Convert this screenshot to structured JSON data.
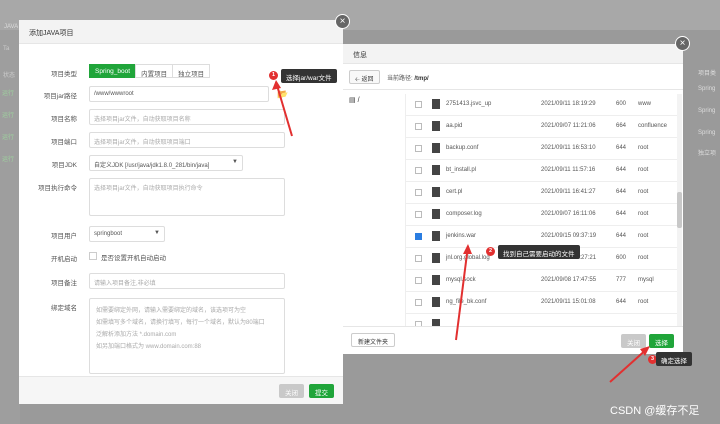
{
  "background": {
    "top_title": "JAVA",
    "left_items": [
      "Ta",
      "状态",
      "运行",
      "运行",
      "运行",
      "运行"
    ],
    "right_items": [
      "项目类",
      "Spring",
      "Spring",
      "Spring",
      "独立项"
    ]
  },
  "dialog": {
    "title": "添加JAVA项目",
    "close_icon": "×",
    "project_type": {
      "label": "项目类型",
      "options": [
        "Spring_boot",
        "内置项目",
        "独立项目"
      ],
      "selected": "Spring_boot"
    },
    "jar_path": {
      "label": "项目jar路径",
      "value": "/www/wwwroot"
    },
    "name": {
      "label": "项目名称",
      "placeholder": "选择项目jar文件，自动获取项目名称"
    },
    "port": {
      "label": "项目端口",
      "placeholder": "选择项目jar文件，自动获取项目端口"
    },
    "jdk": {
      "label": "项目JDK",
      "value": "自定义JDK [/usr/java/jdk1.8.0_281/bin/java]"
    },
    "command": {
      "label": "项目执行命令",
      "placeholder": "选择项目jar文件，自动获取项目执行命令"
    },
    "user": {
      "label": "项目用户",
      "value": "springboot"
    },
    "autostart": {
      "label": "开机启动",
      "text": "是否设置开机自动启动"
    },
    "remark": {
      "label": "项目备注",
      "placeholder": "请输入项目备注,非必填"
    },
    "domain": {
      "label": "绑定域名",
      "lines": [
        "如需要绑定外网，请输入需要绑定的域名，该选项可为空",
        "如需填写多个域名，请换行填写，每行一个域名，默认为80端口",
        "泛解析添加方法 *.domain.com",
        "如另加端口格式为 www.domain.com:88"
      ]
    },
    "close_button": "关闭",
    "submit_button": "提交"
  },
  "file_picker": {
    "title": "信息",
    "back_button": "返回",
    "current_path_label": "当前路径:",
    "current_path": "/tmp/",
    "tree_root": "/",
    "files": [
      {
        "name": "2751413.jsvc_up",
        "date": "2021/09/11 18:19:29",
        "perm": "600",
        "owner": "www",
        "checked": false
      },
      {
        "name": "aa.pid",
        "date": "2021/09/07 11:21:06",
        "perm": "664",
        "owner": "confluence",
        "checked": false
      },
      {
        "name": "backup.conf",
        "date": "2021/09/11 16:53:10",
        "perm": "644",
        "owner": "root",
        "checked": false
      },
      {
        "name": "bt_install.pl",
        "date": "2021/09/11 11:57:16",
        "perm": "644",
        "owner": "root",
        "checked": false
      },
      {
        "name": "cert.pl",
        "date": "2021/09/11 16:41:27",
        "perm": "644",
        "owner": "root",
        "checked": false
      },
      {
        "name": "composer.log",
        "date": "2021/09/07 16:11:06",
        "perm": "644",
        "owner": "root",
        "checked": false
      },
      {
        "name": "jenkins.war",
        "date": "2021/09/15 09:37:19",
        "perm": "644",
        "owner": "root",
        "checked": true
      },
      {
        "name": "jnl.org.global.log",
        "date": "2021/09/08 14:27:21",
        "perm": "600",
        "owner": "root",
        "checked": false
      },
      {
        "name": "mysql.sock",
        "date": "2021/09/08 17:47:55",
        "perm": "777",
        "owner": "mysql",
        "checked": false
      },
      {
        "name": "ng_file_bk.conf",
        "date": "2021/09/11 15:01:08",
        "perm": "644",
        "owner": "root",
        "checked": false
      },
      {
        "name": "",
        "date": "",
        "perm": "",
        "owner": "",
        "checked": false
      }
    ],
    "new_folder_button": "新建文件夹",
    "close_button": "关闭",
    "select_button": "选择"
  },
  "annotations": {
    "step1": {
      "num": "1",
      "text": "选择jar/war文件"
    },
    "step2": {
      "num": "2",
      "text": "找到自己需要启动的文件"
    },
    "step3": {
      "num": "3",
      "text": "确定选择"
    },
    "arrow_color": "#e23030"
  },
  "watermark": "CSDN @缓存不足"
}
